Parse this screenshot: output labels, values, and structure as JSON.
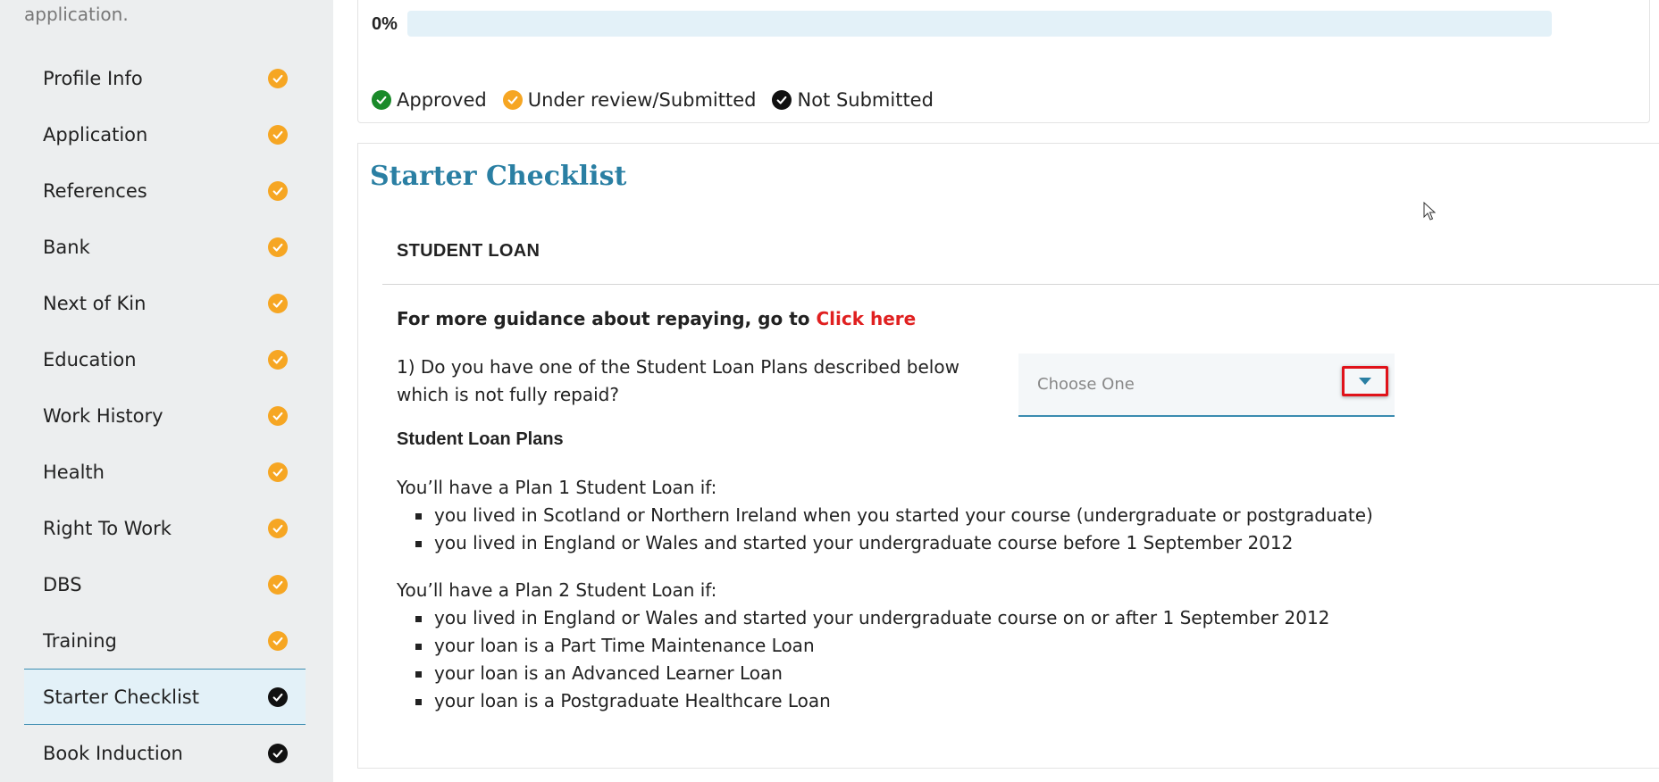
{
  "sidebar": {
    "intro_text": "application.",
    "items": [
      {
        "label": "Profile Info",
        "status": "orange"
      },
      {
        "label": "Application",
        "status": "orange"
      },
      {
        "label": "References",
        "status": "orange"
      },
      {
        "label": "Bank",
        "status": "orange"
      },
      {
        "label": "Next of Kin",
        "status": "orange"
      },
      {
        "label": "Education",
        "status": "orange"
      },
      {
        "label": "Work History",
        "status": "orange"
      },
      {
        "label": "Health",
        "status": "orange"
      },
      {
        "label": "Right To Work",
        "status": "orange"
      },
      {
        "label": "DBS",
        "status": "orange"
      },
      {
        "label": "Training",
        "status": "orange"
      },
      {
        "label": "Starter Checklist",
        "status": "black"
      },
      {
        "label": "Book Induction",
        "status": "black"
      }
    ],
    "active_index": 11
  },
  "progress": {
    "percent_label": "0%",
    "value": 0
  },
  "legend": {
    "approved": "Approved",
    "under_review": "Under review/Submitted",
    "not_submitted": "Not Submitted"
  },
  "checklist": {
    "title": "Starter Checklist",
    "section_header": "STUDENT LOAN",
    "guidance_prefix": "For more guidance about repaying, go to",
    "guidance_link": "Click here",
    "question": "1) Do you have one of the Student Loan Plans described below which is not fully repaid?",
    "select_placeholder": "Choose One",
    "plans_title": "Student Loan Plans",
    "plan1": {
      "intro": "You’ll have a Plan 1 Student Loan if:",
      "items": [
        "you lived in Scotland or Northern Ireland when you started your course (undergraduate or postgraduate)",
        "you lived in England or Wales and started your undergraduate course before 1 September 2012"
      ]
    },
    "plan2": {
      "intro": "You’ll have a Plan 2 Student Loan if:",
      "items": [
        "you lived in England or Wales and started your undergraduate course on or after 1 September 2012",
        "your loan is a Part Time Maintenance Loan",
        "your loan is an Advanced Learner Loan",
        "your loan is a Postgraduate Healthcare Loan"
      ]
    }
  },
  "colors": {
    "accent": "#2a7fa3",
    "link_red": "#e02020",
    "status_orange": "#f6a623",
    "status_green": "#1a8a2a",
    "status_black": "#111111"
  }
}
